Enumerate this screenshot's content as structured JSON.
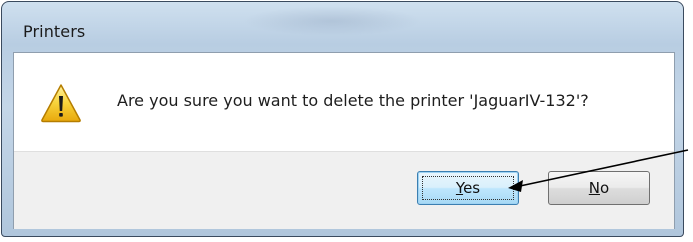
{
  "dialog": {
    "title": "Printers",
    "message": "Are you sure you want to delete the printer 'JaguarIV-132'?",
    "icon": "warning-icon"
  },
  "buttons": {
    "yes": {
      "mnemonic": "Y",
      "rest": "es"
    },
    "no": {
      "mnemonic": "N",
      "rest": "o"
    }
  },
  "colors": {
    "frame": "#c4d6e8",
    "footer": "#f0f0f0",
    "accent": "#3c7fb1"
  }
}
